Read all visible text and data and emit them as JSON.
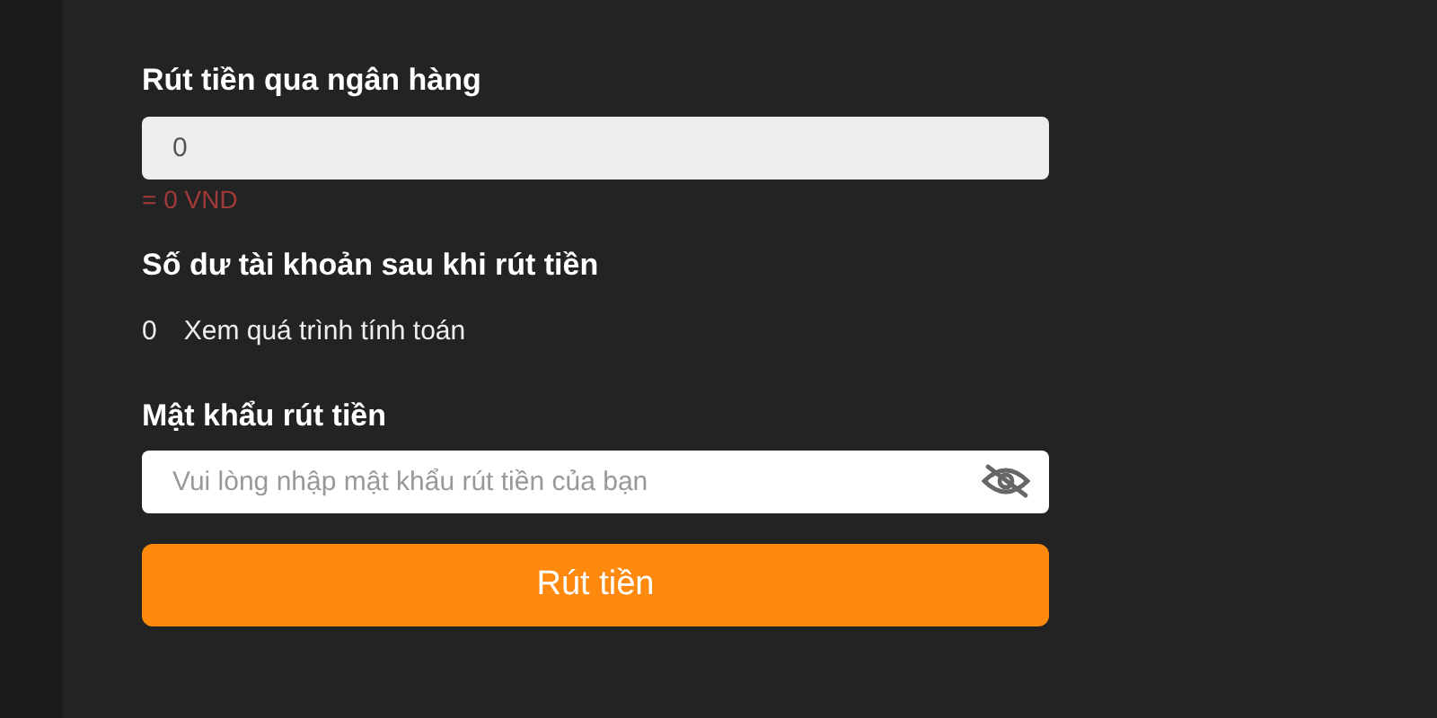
{
  "amount_section": {
    "label": "Rút tiền qua ngân hàng",
    "value": "0",
    "converted": "= 0 VND"
  },
  "balance_section": {
    "label": "Số dư tài khoản sau khi rút tiền",
    "balance": "0",
    "details_link": "Xem quá trình tính toán"
  },
  "password_section": {
    "label": "Mật khẩu rút tiền",
    "placeholder": "Vui lòng nhập mật khẩu rút tiền của bạn"
  },
  "submit_button": "Rút tiền"
}
